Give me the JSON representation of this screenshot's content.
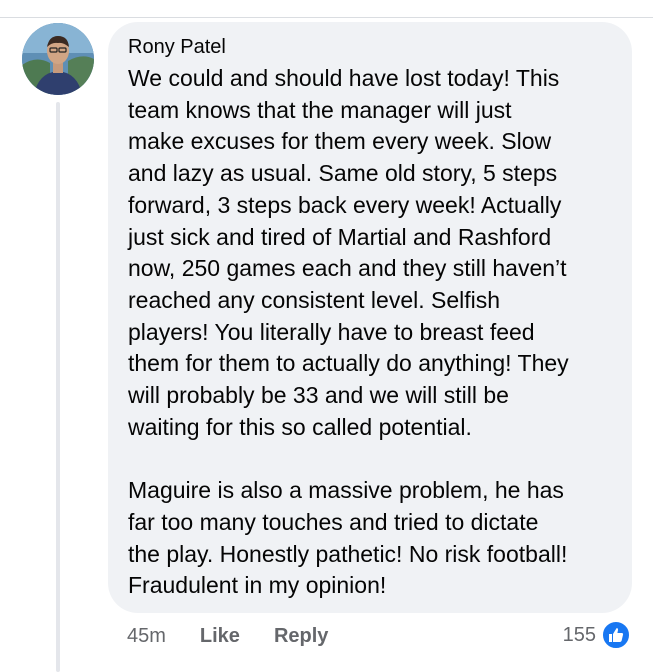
{
  "comment": {
    "author": "Rony Patel",
    "text": "We could and should have lost today! This\nteam knows that the manager will just\nmake excuses for them every week. Slow\nand lazy as usual. Same old story, 5 steps\nforward, 3 steps back every week! Actually\njust sick and tired of Martial and Rashford\nnow, 250 games each and they still haven’t\nreached any consistent level. Selfish\nplayers! You literally have to breast feed\nthem for them to actually do anything! They\nwill probably be 33 and we will still be\nwaiting for this so called potential.\n\nMaguire is also a massive problem, he has\nfar too many touches and tried to dictate\nthe play. Honestly pathetic! No risk football!\nFraudulent in my opinion!",
    "timestamp": "45m",
    "like_label": "Like",
    "reply_label": "Reply",
    "reaction_count": "155",
    "reaction_icon": "thumbs-up-icon"
  },
  "colors": {
    "bubble": "#f0f2f5",
    "text": "#050505",
    "meta": "#65676b",
    "accent": "#1877f2"
  }
}
